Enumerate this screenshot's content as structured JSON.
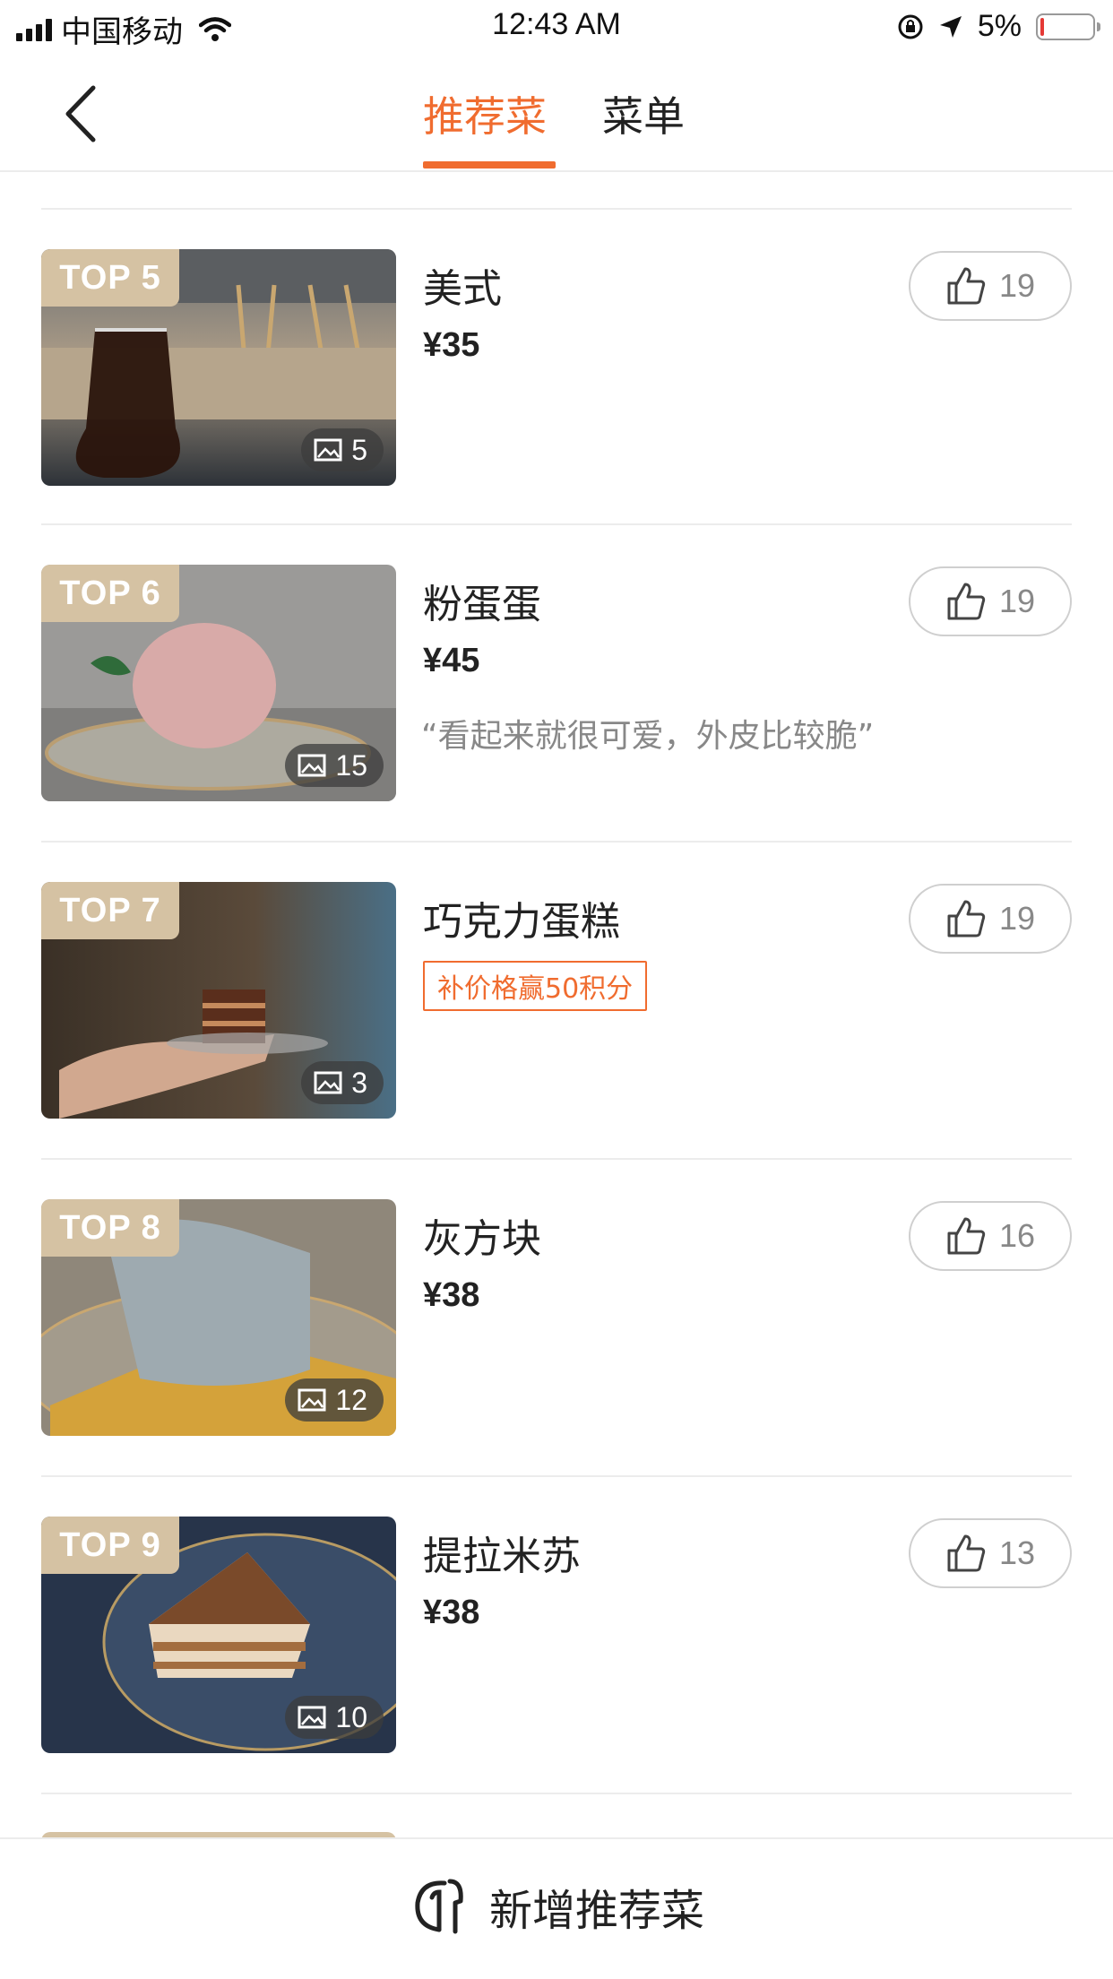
{
  "status": {
    "carrier": "中国移动",
    "time": "12:43 AM",
    "battery": "5%",
    "battery_level": 0.05
  },
  "nav": {
    "tabs": [
      {
        "label": "推荐菜",
        "active": true
      },
      {
        "label": "菜单",
        "active": false
      }
    ]
  },
  "items": [
    {
      "rank": "TOP 5",
      "name": "美式",
      "price": "¥35",
      "photos": "5",
      "likes": "19",
      "quote": "",
      "promo": ""
    },
    {
      "rank": "TOP 6",
      "name": "粉蛋蛋",
      "price": "¥45",
      "photos": "15",
      "likes": "19",
      "quote": "“看起来就很可爱，外皮比较脆”",
      "promo": ""
    },
    {
      "rank": "TOP 7",
      "name": "巧克力蛋糕",
      "price": "",
      "photos": "3",
      "likes": "19",
      "quote": "",
      "promo": "补价格赢50积分"
    },
    {
      "rank": "TOP 8",
      "name": "灰方块",
      "price": "¥38",
      "photos": "12",
      "likes": "16",
      "quote": "",
      "promo": ""
    },
    {
      "rank": "TOP 9",
      "name": "提拉米苏",
      "price": "¥38",
      "photos": "10",
      "likes": "13",
      "quote": "",
      "promo": ""
    }
  ],
  "bottom": {
    "add_label": "新增推荐菜"
  },
  "colors": {
    "accent": "#f06c2f",
    "badge": "#d5c2a3"
  }
}
